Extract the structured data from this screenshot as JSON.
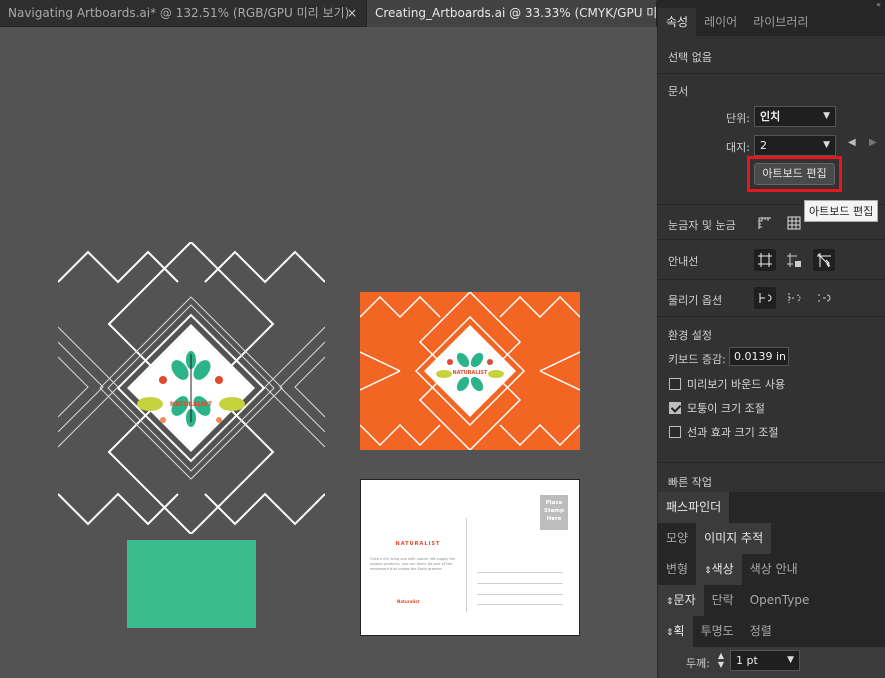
{
  "doc_tabs": [
    {
      "label": "Navigating  Artboards.ai*  @  132.51%  (RGB/GPU 미리 보기)",
      "close": "×"
    },
    {
      "label": "Creating_Artboards.ai  @  33.33%  (CMYK/GPU 미리 보기)"
    }
  ],
  "artboards": {
    "title1": "NATURALIST",
    "title2": "NATURALIST",
    "postcard_title": "NATURALIST",
    "stamp": "Place Stamp Here",
    "postcard_body": "Once a life living one with nature. We supply the organic products, you can them, be part of the movement that makes the Earth greener.",
    "signature": "Naturalist"
  },
  "panel": {
    "tabs": [
      "속성",
      "레이어",
      "라이브러리"
    ],
    "no_selection": "선택 없음",
    "doc_heading": "문서",
    "unit_label": "단위:",
    "unit_value": "인치",
    "artboard_label": "대지:",
    "artboard_value": "2",
    "edit_artboards_button": "아트보드 편집",
    "tooltip": "아트보드 편집",
    "rulers_label": "눈금자 및 눈금",
    "guides_label": "안내선",
    "snap_label": "물리기 옵션",
    "prefs_heading": "환경 설정",
    "keyboard_inc_label": "키보드 증감:",
    "keyboard_inc_value": "0.0139 in",
    "cb_preview_bounds": "미리보기 바운드 사용",
    "cb_scale_corners": "모퉁이 크기 조절",
    "cb_scale_strokes": "선과 효과 크기 조절",
    "quick_actions": "빠른 작업",
    "strip1": [
      "패스파인더"
    ],
    "strip2": [
      "모양",
      "이미지 추적"
    ],
    "strip3": [
      "변형",
      "색상",
      "색상 안내"
    ],
    "strip4": [
      "문자",
      "단락",
      "OpenType"
    ],
    "strip5": [
      "획",
      "투명도",
      "정렬"
    ],
    "weight_label": "두께:",
    "weight_value": "1 pt"
  },
  "colors": {
    "orange": "#f26522",
    "green": "#3bbd8f",
    "leaf": "#2bb38b",
    "accent": "#e04a2a"
  }
}
